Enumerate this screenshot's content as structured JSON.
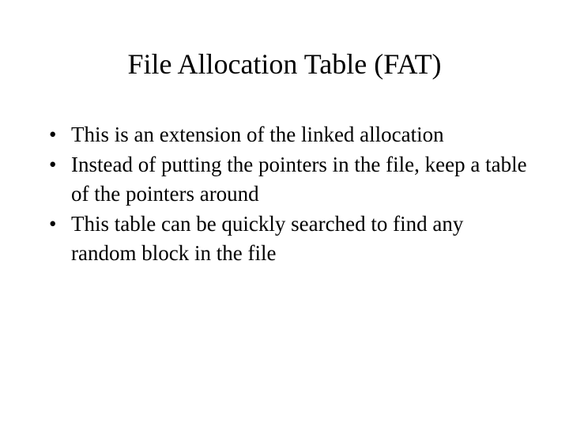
{
  "slide": {
    "title": "File Allocation Table (FAT)",
    "bullets": [
      "This is an extension of the linked allocation",
      "Instead of putting the pointers in the file, keep a table of the pointers around",
      "This table can be quickly searched to find any random block in the file"
    ]
  }
}
